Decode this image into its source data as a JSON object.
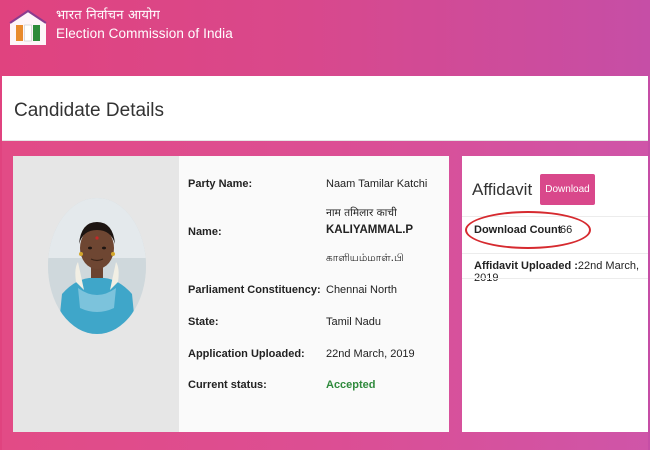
{
  "header": {
    "brand_hindi": "भारत निर्वाचन आयोग",
    "brand_english": "Election Commission of India",
    "logo_icon": "eci-ballot-box-logo"
  },
  "card": {
    "title": "Candidate Details"
  },
  "candidate": {
    "fields": [
      {
        "label": "Party Name:",
        "value": "Naam Tamilar Katchi"
      },
      {
        "label": "Name:",
        "value_hindi": "नाम तमिलार काची",
        "value": "KALIYAMMAL.P",
        "value_tamil": "காளியம்மாள்.பி"
      },
      {
        "label": "Parliament Constituency:",
        "value": "Chennai North"
      },
      {
        "label": "State:",
        "value": "Tamil Nadu"
      },
      {
        "label": "Application Uploaded:",
        "value": "22nd March, 2019"
      },
      {
        "label": "Current status:",
        "value": "Accepted"
      }
    ],
    "photo_icon": "candidate-photo"
  },
  "affidavit": {
    "title": "Affidavit",
    "download_label": "Download",
    "download_count_label": "Download Count",
    "download_count": "66",
    "uploaded_label": "Affidavit Uploaded :",
    "uploaded_date": "22nd March, 2019"
  },
  "colors": {
    "brand_pink": "#d9488b",
    "status_green": "#2f8a3c",
    "highlight_red": "#d62a2f"
  }
}
